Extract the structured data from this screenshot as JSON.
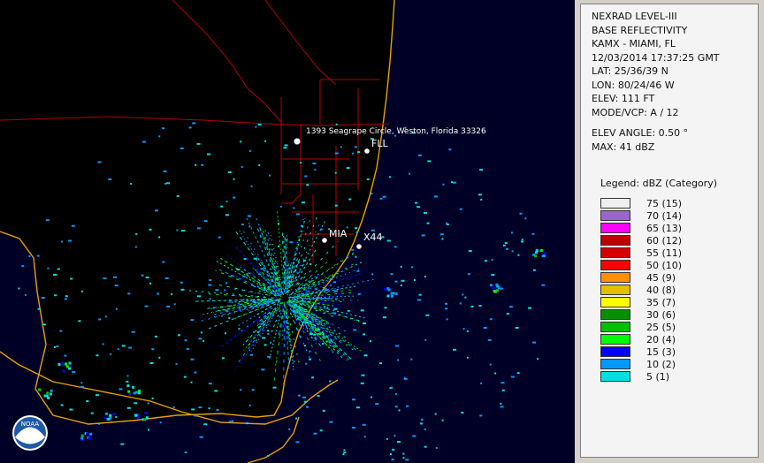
{
  "radar_info": {
    "product": "NEXRAD LEVEL-III",
    "product_type": "BASE REFLECTIVITY",
    "station": "KAMX - MIAMI, FL",
    "datetime": "12/03/2014 17:37:25 GMT",
    "lat": "LAT: 25/36/39 N",
    "lon": "LON: 80/24/46 W",
    "elev": "ELEV: 111 FT",
    "mode_vcp": "MODE/VCP: A / 12",
    "elev_angle": "ELEV ANGLE: 0.50 °",
    "max": "MAX: 41 dBZ"
  },
  "legend": {
    "title": "Legend: dBZ (Category)",
    "items": [
      {
        "label": "75  (15)",
        "color": "#eeeeee"
      },
      {
        "label": "70  (14)",
        "color": "#9966cc"
      },
      {
        "label": "65  (13)",
        "color": "#ff00ff"
      },
      {
        "label": "60  (12)",
        "color": "#c00000"
      },
      {
        "label": "55  (11)",
        "color": "#d40000"
      },
      {
        "label": "50  (10)",
        "color": "#ff0000"
      },
      {
        "label": "45  (9)",
        "color": "#ff9000"
      },
      {
        "label": "40  (8)",
        "color": "#e0c000"
      },
      {
        "label": "35  (7)",
        "color": "#ffff00"
      },
      {
        "label": "30  (6)",
        "color": "#009000"
      },
      {
        "label": "25  (5)",
        "color": "#00c000"
      },
      {
        "label": "20  (4)",
        "color": "#00ff00"
      },
      {
        "label": "15  (3)",
        "color": "#0000ff"
      },
      {
        "label": "10  (2)",
        "color": "#0099ff"
      },
      {
        "label": "5  (1)",
        "color": "#00e0e0"
      }
    ]
  },
  "map": {
    "address_label": "1393 Seagrape Circle, Weston, Florida 33326",
    "places": [
      {
        "name": "FLL"
      },
      {
        "name": "MIA"
      },
      {
        "name": "X44"
      }
    ],
    "logo_text": "NOAA",
    "colors": {
      "land": "#000000",
      "ocean": "#000028",
      "coast": "#e8a000",
      "county": "#b40000"
    }
  }
}
